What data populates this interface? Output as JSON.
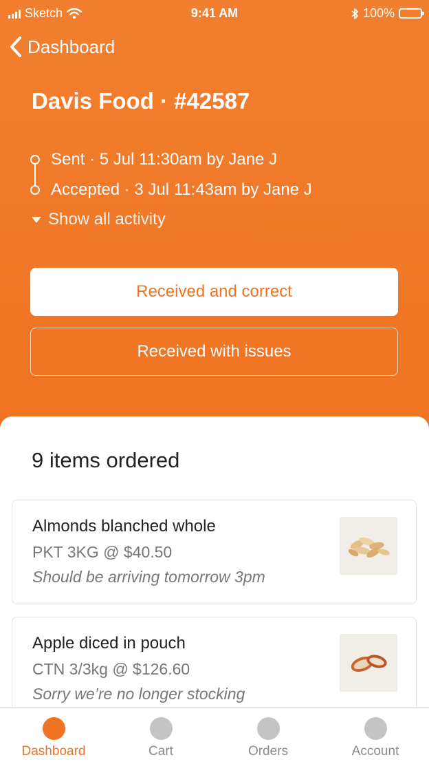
{
  "status_bar": {
    "carrier": "Sketch",
    "time": "9:41 AM",
    "battery": "100%"
  },
  "nav": {
    "back_label": "Dashboard"
  },
  "order": {
    "title": "Davis Food · #42587",
    "activity": [
      "Sent · 5 Jul 11:30am by Jane J",
      "Accepted · 3 Jul 11:43am by Jane J"
    ],
    "show_all_label": "Show all activity"
  },
  "actions": {
    "received_correct": "Received and correct",
    "received_issues": "Received with issues"
  },
  "items": {
    "heading": "9 items ordered",
    "list": [
      {
        "name": "Almonds blanched whole",
        "price": "PKT 3KG @ $40.50",
        "note": "Should be arriving tomorrow 3pm",
        "image": "almonds"
      },
      {
        "name": "Apple diced in pouch",
        "price": "CTN 3/3kg @ $126.60",
        "note": "Sorry we’re no longer stocking",
        "image": "apple-pouch"
      }
    ]
  },
  "tabbar": {
    "tabs": [
      {
        "label": "Dashboard",
        "active": true
      },
      {
        "label": "Cart",
        "active": false
      },
      {
        "label": "Orders",
        "active": false
      },
      {
        "label": "Account",
        "active": false
      }
    ]
  },
  "colors": {
    "accent": "#ef7322",
    "inactive": "#c4c4c4"
  }
}
